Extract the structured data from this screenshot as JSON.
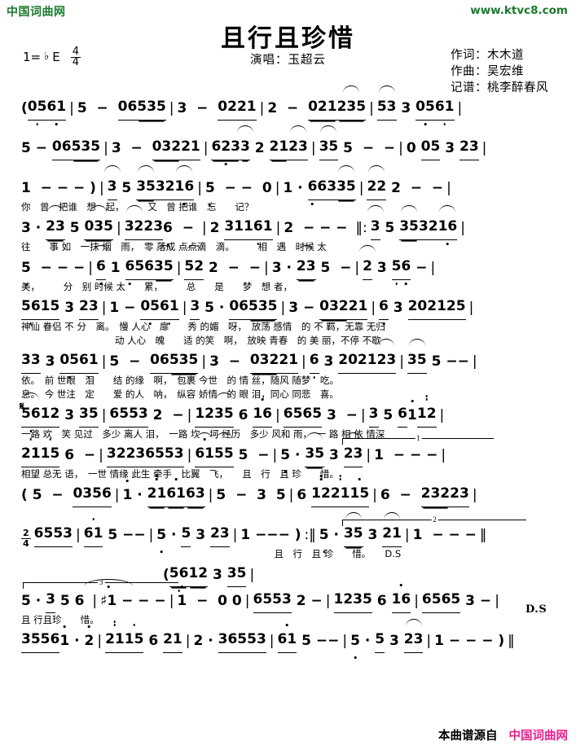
{
  "watermark": {
    "top_left": "中国词曲网",
    "top_right": "www.ktvc8.com",
    "top_left_color": "#1a7a2e",
    "top_right_color": "#1a7a2e"
  },
  "header": {
    "title": "且行且珍惜",
    "singer_label": "演唱：玉超云",
    "credits": [
      "作词：木木道",
      "作曲：吴宏维",
      "记谱：桃李醉春风"
    ]
  },
  "key_signature": {
    "do_equals_label": "1=",
    "key": "E",
    "accidental": "♭",
    "meter_numerator": "4",
    "meter_denominator": "4"
  },
  "score": {
    "notation_type": "jianpu",
    "systems": [
      {
        "id": "system-1",
        "notes": "( 05 61 | 5 − 06 535 | 3 − 02 21 | 2 − 021 235 | 53 3 05 61 |",
        "lyrics_1": "",
        "lyrics_2": ""
      },
      {
        "id": "system-2",
        "notes": "5 − 06 535 | 3 − 032 21 | 623 3 2 21 23 | 35 5 − − | 0 05 3 23 |",
        "lyrics_1": "",
        "lyrics_2": ""
      },
      {
        "id": "system-3",
        "notes": "1 − − − ) | 3 5 35 32 16 | 5 − − 0 | 1 · 6 63 35 | 22 2 − − |",
        "lyrics_1": "你　曾　把谁　想　起，　　　又　曾 把谁　忘　　记？",
        "lyrics_2": ""
      },
      {
        "id": "system-4",
        "notes": "3 · 23 5 035 | 32 23 6 − | 2 31 1 6 1 | 2 − − − ‖: 3 5 35 32 16 |",
        "lyrics_1": "往　　事 如　一抹 烟　雨，　零 落成 点点滴　滴。　　　相　遇　时候 太",
        "lyrics_2": ""
      },
      {
        "id": "system-5",
        "notes": "5 − − − | 6 1 6 56 35 | 52 2 − − | 3 · 23 5 − | 2 3 5 6 − |",
        "lyrics_1": "美，　　　分　别 时候 太　　累，　　　总　　是　　梦　想 者，",
        "lyrics_2": ""
      },
      {
        "id": "system-6",
        "notes": "56 15 3 23 | 1 − 05 61 | 3 5 · 06 535 | 3 − 032 21 | 6 3 2 021 25 |",
        "lyrics_1": "神仙 眷侣 不 分　离。　慢 人心　扉　　秀 的媚　呀，　放荡 感情　的 不 羁，无靠 无归",
        "lyrics_2": "　　　　　　　　　　动 人心　魄　　适 的笑　啊，　放映 青春　的 美 丽，不停 不歇"
      },
      {
        "id": "system-7",
        "notes": "33 3 05 61 | 5 − 06 535 | 3 − 032 21 | 6 3 2 021 23 | 35 5 − − |",
        "lyrics_1": "依。　前 世眼　泪　　结 的缘　啊，　包裹 今世　的 情 丝，随风 随梦　吃。",
        "lyrics_2": "息。　今 世注　定　　爱 的人　呐，　纵容 娇情　的 眼 泪，同心 同悲　喜。"
      },
      {
        "id": "system-8",
        "notes": "56 12 3 35 | 65 53 2 − | 12 35 6 16 | 65 65 3 − | 3 5 6 1 12 |",
        "lyrics_1": "一路 欢　笑 见过　多少 离人 泪，　一路 坎　坷 经历　多少 风和 雨，　一 路 相 依 情深",
        "lyrics_2": ""
      },
      {
        "id": "system-9",
        "notes": "21 15 6 − | 32 23 65 53 | 61 55 5 − | 5 · 35 3 23 | 1 − − − |",
        "lyrics_1": "相望 总无 语，　一世 情缘 此生 牵手　比翼　飞，　　且　行　且 珍　　惜。",
        "lyrics_2": ""
      },
      {
        "id": "system-10",
        "notes": "( 5 − 03 56 | 1 · 21 61 63 | 5 − 3 5 | 6 12 21 15 | 6 − 232 23 |",
        "lyrics_1": "",
        "lyrics_2": ""
      },
      {
        "id": "system-11",
        "notes": "2/4 65 53 | 61 5 − − | 5 · 5 3 23 | 1 − − − ) :‖ 5 · 35 3 21 | 1 − − − ‖",
        "lyrics_1": "　　　　　　　　　　　　　　　　　　　　　　　　　　　且　行　且 珍　　惜。　　D.S",
        "lyrics_2": ""
      },
      {
        "id": "system-12",
        "notes": "( 56 12 3 35 |",
        "lyrics_1": "",
        "lyrics_2": ""
      },
      {
        "id": "system-13",
        "notes": "5 · 3 5 6 | ♯1 − − − | 1 − 0 0 | 65 53 2 − | 12 35 6 16 | 65 65 3 − |",
        "lyrics_1": "且 行且珍　　惜。",
        "lyrics_2": ""
      },
      {
        "id": "system-14",
        "notes": "35 56 1 · 2 | 21 15 6 21 | 2 · 3 65 53 | 61 5 − − | 5 · 5 3 23 | 1 − − − ) ‖",
        "lyrics_1": "",
        "lyrics_2": ""
      }
    ],
    "markings": {
      "segno": "𝄋",
      "ds": "D.S",
      "volta_1": "1",
      "volta_2": "2",
      "tuplet_3": "3",
      "repeat_open": "‖:",
      "repeat_close": ":‖",
      "final_barline": "‖"
    }
  },
  "footer": {
    "source_label": "本曲谱源自",
    "site_label": "中国词曲网",
    "site_color": "#ee1d8f"
  }
}
